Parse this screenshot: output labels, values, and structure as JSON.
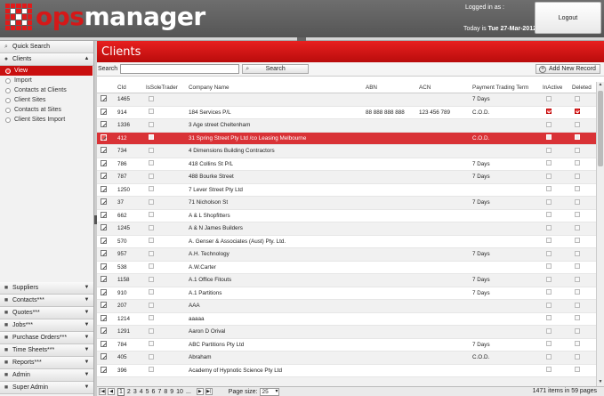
{
  "header": {
    "logo_ops": "ops",
    "logo_manager": "manager",
    "logged_in_label": "Logged in as :",
    "today_prefix": "Today is",
    "today_date": "Tue 27-Mar-2012",
    "logout_label": "Logout"
  },
  "sidebar": {
    "quick_search": "Quick Search",
    "clients": "Clients",
    "client_items": [
      {
        "label": "View"
      },
      {
        "label": "Import"
      },
      {
        "label": "Contacts at Clients"
      },
      {
        "label": "Client Sites"
      },
      {
        "label": "Contacts at Sites"
      },
      {
        "label": "Client Sites Import"
      }
    ],
    "bottom_sections": [
      {
        "label": "Suppliers",
        "icon": "people-icon"
      },
      {
        "label": "Contacts***",
        "icon": "contacts-icon"
      },
      {
        "label": "Quotes***",
        "icon": "quotes-icon"
      },
      {
        "label": "Jobs***",
        "icon": "jobs-icon"
      },
      {
        "label": "Purchase Orders***",
        "icon": "purchase-icon"
      },
      {
        "label": "Time Sheets***",
        "icon": "timesheet-icon"
      },
      {
        "label": "Reports***",
        "icon": "reports-icon"
      },
      {
        "label": "Admin",
        "icon": "admin-icon"
      },
      {
        "label": "Super Admin",
        "icon": "superadmin-icon"
      }
    ]
  },
  "main": {
    "title": "Clients",
    "search_label": "Search",
    "search_value": "",
    "search_button": "Search",
    "add_button": "Add New Record"
  },
  "grid": {
    "columns": {
      "cid": "CId",
      "sole": "IsSoleTrader",
      "name": "Company Name",
      "abn": "ABN",
      "acn": "ACN",
      "term": "Payment Trading Term",
      "inactive": "InActive",
      "deleted": "Deleted"
    },
    "rows": [
      {
        "cid": "1465",
        "name": "",
        "abn": "",
        "acn": "",
        "term": "7 Days",
        "inactive": false,
        "deleted": false
      },
      {
        "cid": "914",
        "name": "184 Services P/L",
        "abn": "88 888 888 888",
        "acn": "123 456 789",
        "term": "C.O.D.",
        "inactive": true,
        "deleted": true
      },
      {
        "cid": "1336",
        "name": "3 Age street Cheltenham",
        "abn": "",
        "acn": "",
        "term": "",
        "inactive": false,
        "deleted": false
      },
      {
        "cid": "412",
        "name": "31 Spring Street Pty Ltd /co Leasing Melbourne",
        "abn": "",
        "acn": "",
        "term": "C.O.D.",
        "inactive": false,
        "deleted": false,
        "selected": true
      },
      {
        "cid": "734",
        "name": "4 Dimensions Building Contractors",
        "abn": "",
        "acn": "",
        "term": "",
        "inactive": false,
        "deleted": false
      },
      {
        "cid": "786",
        "name": "418 Collins St P/L",
        "abn": "",
        "acn": "",
        "term": "7 Days",
        "inactive": false,
        "deleted": false
      },
      {
        "cid": "787",
        "name": "488 Bourke Street",
        "abn": "",
        "acn": "",
        "term": "7 Days",
        "inactive": false,
        "deleted": false
      },
      {
        "cid": "1250",
        "name": "7 Lever Street Pty Ltd",
        "abn": "",
        "acn": "",
        "term": "",
        "inactive": false,
        "deleted": false
      },
      {
        "cid": "37",
        "name": "71 Nicholson St",
        "abn": "",
        "acn": "",
        "term": "7 Days",
        "inactive": false,
        "deleted": false
      },
      {
        "cid": "662",
        "name": "A & L Shopfitters",
        "abn": "",
        "acn": "",
        "term": "",
        "inactive": false,
        "deleted": false
      },
      {
        "cid": "1245",
        "name": "A & N James Builders",
        "abn": "",
        "acn": "",
        "term": "",
        "inactive": false,
        "deleted": false
      },
      {
        "cid": "570",
        "name": "A. Genser & Associates (Aust) Pty. Ltd.",
        "abn": "",
        "acn": "",
        "term": "",
        "inactive": false,
        "deleted": false
      },
      {
        "cid": "957",
        "name": "A.H. Technology",
        "abn": "",
        "acn": "",
        "term": "7 Days",
        "inactive": false,
        "deleted": false
      },
      {
        "cid": "538",
        "name": "A.W.Carter",
        "abn": "",
        "acn": "",
        "term": "",
        "inactive": false,
        "deleted": false
      },
      {
        "cid": "1158",
        "name": "A.1 Office Fitouts",
        "abn": "",
        "acn": "",
        "term": "7 Days",
        "inactive": false,
        "deleted": false
      },
      {
        "cid": "910",
        "name": "A.1 Partitions",
        "abn": "",
        "acn": "",
        "term": "7 Days",
        "inactive": false,
        "deleted": false
      },
      {
        "cid": "207",
        "name": "AAA",
        "abn": "",
        "acn": "",
        "term": "",
        "inactive": false,
        "deleted": false
      },
      {
        "cid": "1214",
        "name": "aaaaa",
        "abn": "",
        "acn": "",
        "term": "",
        "inactive": false,
        "deleted": false
      },
      {
        "cid": "1291",
        "name": "Aaron D Orival",
        "abn": "",
        "acn": "",
        "term": "",
        "inactive": false,
        "deleted": false
      },
      {
        "cid": "784",
        "name": "ABC Partitions Pty Ltd",
        "abn": "",
        "acn": "",
        "term": "7 Days",
        "inactive": false,
        "deleted": false
      },
      {
        "cid": "405",
        "name": "Abraham",
        "abn": "",
        "acn": "",
        "term": "C.O.D.",
        "inactive": false,
        "deleted": false
      },
      {
        "cid": "396",
        "name": "Academy of Hypnotic Science Pty Ltd",
        "abn": "",
        "acn": "",
        "term": "",
        "inactive": false,
        "deleted": false
      },
      {
        "cid": "",
        "name": "",
        "abn": "",
        "acn": "",
        "term": "",
        "inactive": false,
        "deleted": false
      }
    ]
  },
  "pager": {
    "pages": [
      "1",
      "2",
      "3",
      "4",
      "5",
      "6",
      "7",
      "8",
      "9",
      "10",
      "..."
    ],
    "current": "1",
    "page_size_label": "Page size:",
    "page_size": "25",
    "summary": "1471 items in 59 pages"
  },
  "colors": {
    "accent": "#d51818",
    "selected_row": "#d93236"
  }
}
